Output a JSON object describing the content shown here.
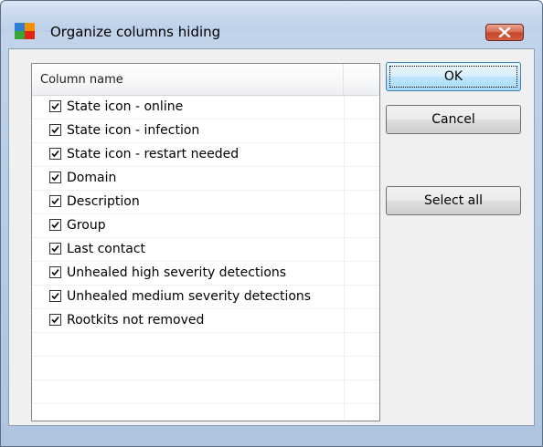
{
  "window": {
    "title": "Organize columns hiding",
    "icon": "avg-logo-icon",
    "close_icon": "close-icon"
  },
  "list": {
    "header": "Column name",
    "items": [
      {
        "label": "State icon - online",
        "checked": true
      },
      {
        "label": "State icon - infection",
        "checked": true
      },
      {
        "label": "State icon - restart needed",
        "checked": true
      },
      {
        "label": "Domain",
        "checked": true
      },
      {
        "label": "Description",
        "checked": true
      },
      {
        "label": "Group",
        "checked": true
      },
      {
        "label": "Last contact",
        "checked": true
      },
      {
        "label": "Unhealed high severity detections",
        "checked": true
      },
      {
        "label": "Unhealed medium severity detections",
        "checked": true
      },
      {
        "label": "Rootkits not removed",
        "checked": true
      }
    ]
  },
  "buttons": {
    "ok": "OK",
    "cancel": "Cancel",
    "select_all": "Select all"
  },
  "colors": {
    "title_bar": "#c9d9ee",
    "close_button": "#c4472c",
    "dialog_bg": "#f0f0f0",
    "default_button": "#bee6fd"
  }
}
